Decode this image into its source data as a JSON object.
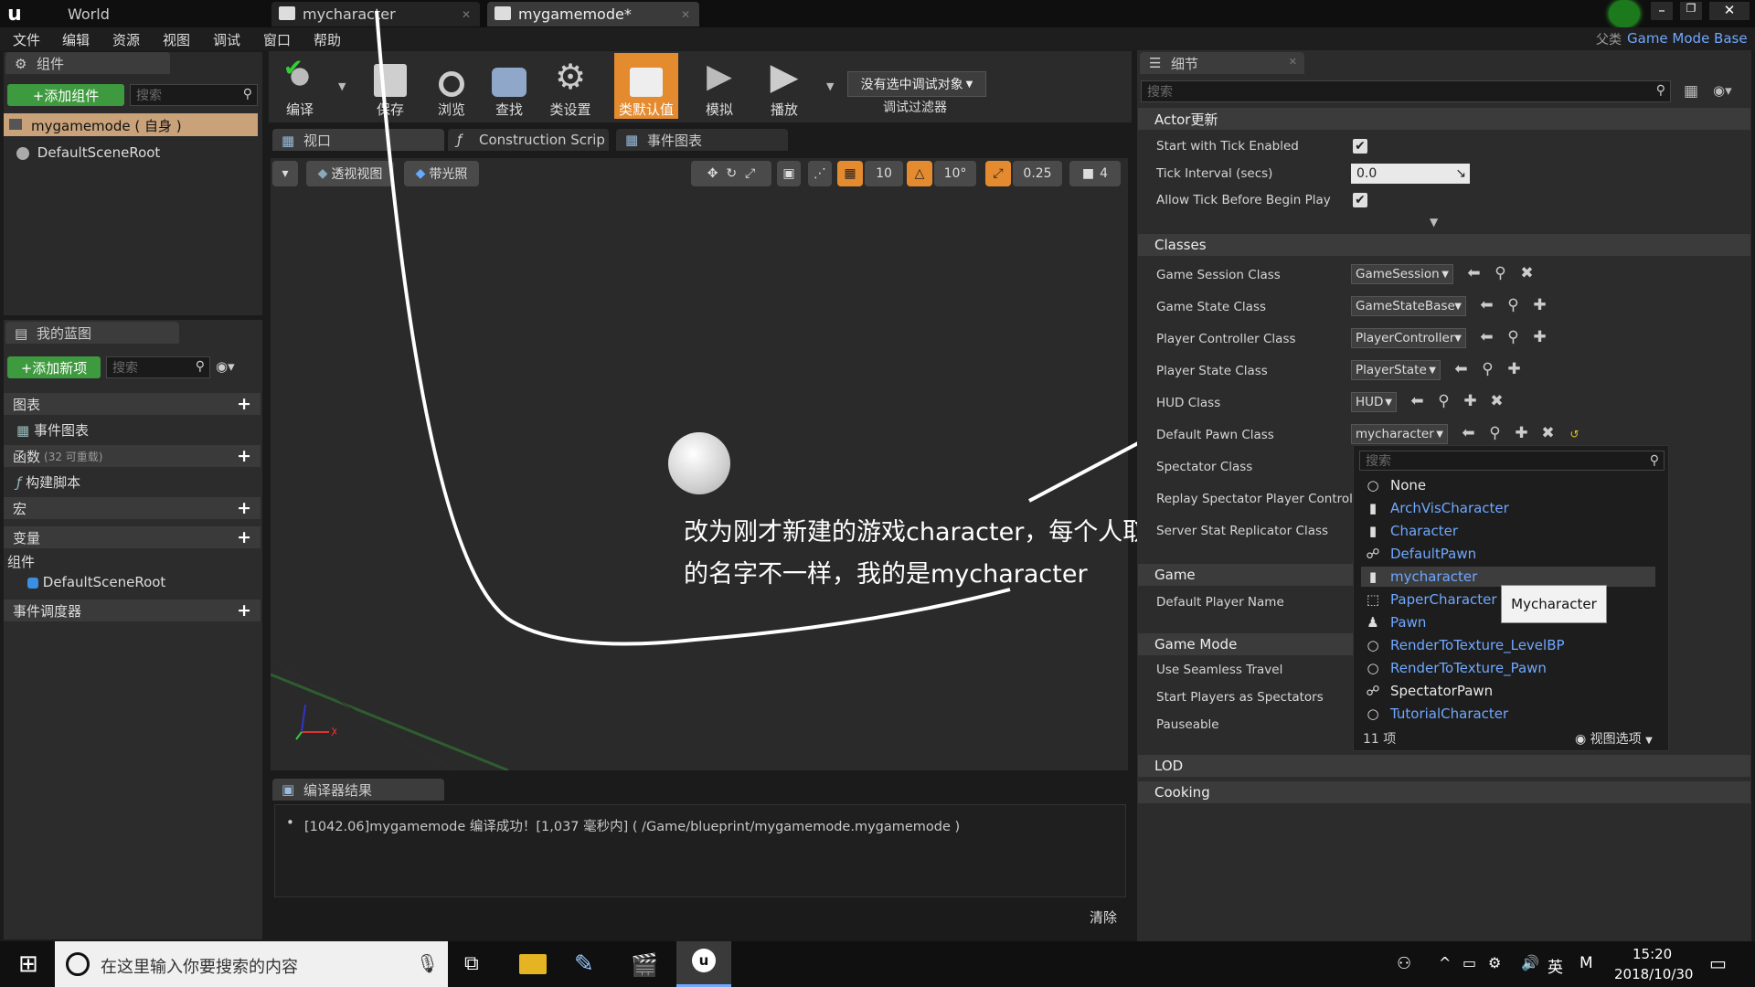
{
  "title_bar": {
    "world_label": "World",
    "tabs": [
      {
        "label": "mycharacter",
        "active": false
      },
      {
        "label": "mygamemode*",
        "active": true
      }
    ],
    "parent_class_label": "父类",
    "parent_class_value": "Game Mode Base"
  },
  "menu": [
    "文件",
    "编辑",
    "资源",
    "视图",
    "调试",
    "窗口",
    "帮助"
  ],
  "components_panel": {
    "tab": "组件",
    "add_button": "+添加组件",
    "search_placeholder": "搜索",
    "root_item": "mygamemode ( 自身 )",
    "child_item": "DefaultSceneRoot"
  },
  "blueprint_panel": {
    "tab": "我的蓝图",
    "add_button": "+添加新项",
    "search_placeholder": "搜索",
    "graphs_label": "图表",
    "event_graph": "事件图表",
    "functions_label": "函数",
    "functions_count": "(32 可重载)",
    "construction_script": "构建脚本",
    "macros_label": "宏",
    "variables_label": "变量",
    "components_label": "组件",
    "components_item": "DefaultSceneRoot",
    "event_dispatchers": "事件调度器"
  },
  "toolbar": {
    "compile": "编译",
    "save": "保存",
    "browse": "浏览",
    "find": "查找",
    "class_settings": "类设置",
    "class_defaults": "类默认值",
    "simulate": "模拟",
    "play": "播放",
    "debug_object": "没有选中调试对象",
    "debug_filter": "调试过滤器"
  },
  "editor_tabs": [
    "视口",
    "Construction Scrip",
    "事件图表"
  ],
  "viewport_controls": {
    "perspective": "透视视图",
    "lit": "带光照",
    "grid_snap": "10",
    "rot_snap": "10°",
    "scale_snap": "0.25",
    "camera_speed": "4"
  },
  "annotation": {
    "line1": "改为刚才新建的游戏character，每个人取",
    "line2": "的名字不一样，我的是mycharacter"
  },
  "compiler": {
    "tab": "编译器结果",
    "message": "[1042.06]mygamemode 编译成功！[1,037 毫秒内] ( /Game/blueprint/mygamemode.mygamemode )",
    "clear": "清除"
  },
  "details": {
    "tab": "细节",
    "search_placeholder": "搜索",
    "actor_section": "Actor更新",
    "start_tick": "Start with Tick Enabled",
    "tick_interval": "Tick Interval (secs)",
    "tick_interval_value": "0.0",
    "allow_tick": "Allow Tick Before Begin Play",
    "classes_section": "Classes",
    "game_session": "Game Session Class",
    "game_session_value": "GameSession",
    "game_state": "Game State Class",
    "game_state_value": "GameStateBase",
    "player_controller": "Player Controller Class",
    "player_controller_value": "PlayerController",
    "player_state": "Player State Class",
    "player_state_value": "PlayerState",
    "hud": "HUD Class",
    "hud_value": "HUD",
    "default_pawn": "Default Pawn Class",
    "default_pawn_value": "mycharacter",
    "spectator": "Spectator Class",
    "replay_spectator": "Replay Spectator Player Control",
    "server_stat": "Server Stat Replicator Class",
    "game_section": "Game",
    "default_player_name": "Default Player Name",
    "game_mode_section": "Game Mode",
    "seamless": "Use Seamless Travel",
    "start_spectators": "Start Players as Spectators",
    "pauseable": "Pauseable",
    "lod_section": "LOD",
    "cooking_section": "Cooking"
  },
  "dropdown": {
    "search_placeholder": "搜索",
    "items": [
      {
        "label": "None",
        "icon": "circle-icon",
        "white": true
      },
      {
        "label": "ArchVisCharacter",
        "icon": "character-icon",
        "white": false
      },
      {
        "label": "Character",
        "icon": "character-icon",
        "white": false
      },
      {
        "label": "DefaultPawn",
        "icon": "pawn-icon",
        "white": false
      },
      {
        "label": "mycharacter",
        "icon": "character-icon",
        "white": false
      },
      {
        "label": "PaperCharacter",
        "icon": "paper-icon",
        "white": false
      },
      {
        "label": "Pawn",
        "icon": "pawn-icon",
        "white": false
      },
      {
        "label": "RenderToTexture_LevelBP",
        "icon": "circle-icon",
        "white": false
      },
      {
        "label": "RenderToTexture_Pawn",
        "icon": "circle-icon",
        "white": false
      },
      {
        "label": "SpectatorPawn",
        "icon": "pawn-icon",
        "white": true
      },
      {
        "label": "TutorialCharacter",
        "icon": "circle-icon",
        "white": false
      }
    ],
    "count": "11 项",
    "view_options": "视图选项",
    "tooltip": "Mycharacter"
  },
  "taskbar": {
    "search_placeholder": "在这里输入你要搜索的内容",
    "ime_lang": "英",
    "ime_mode": "M",
    "time": "15:20",
    "date": "2018/10/30"
  },
  "colors": {
    "accent_orange": "#e58b2f",
    "link_blue": "#6fa8ff",
    "green_button": "#3e9a3e",
    "selected_row": "#c9a27a"
  }
}
